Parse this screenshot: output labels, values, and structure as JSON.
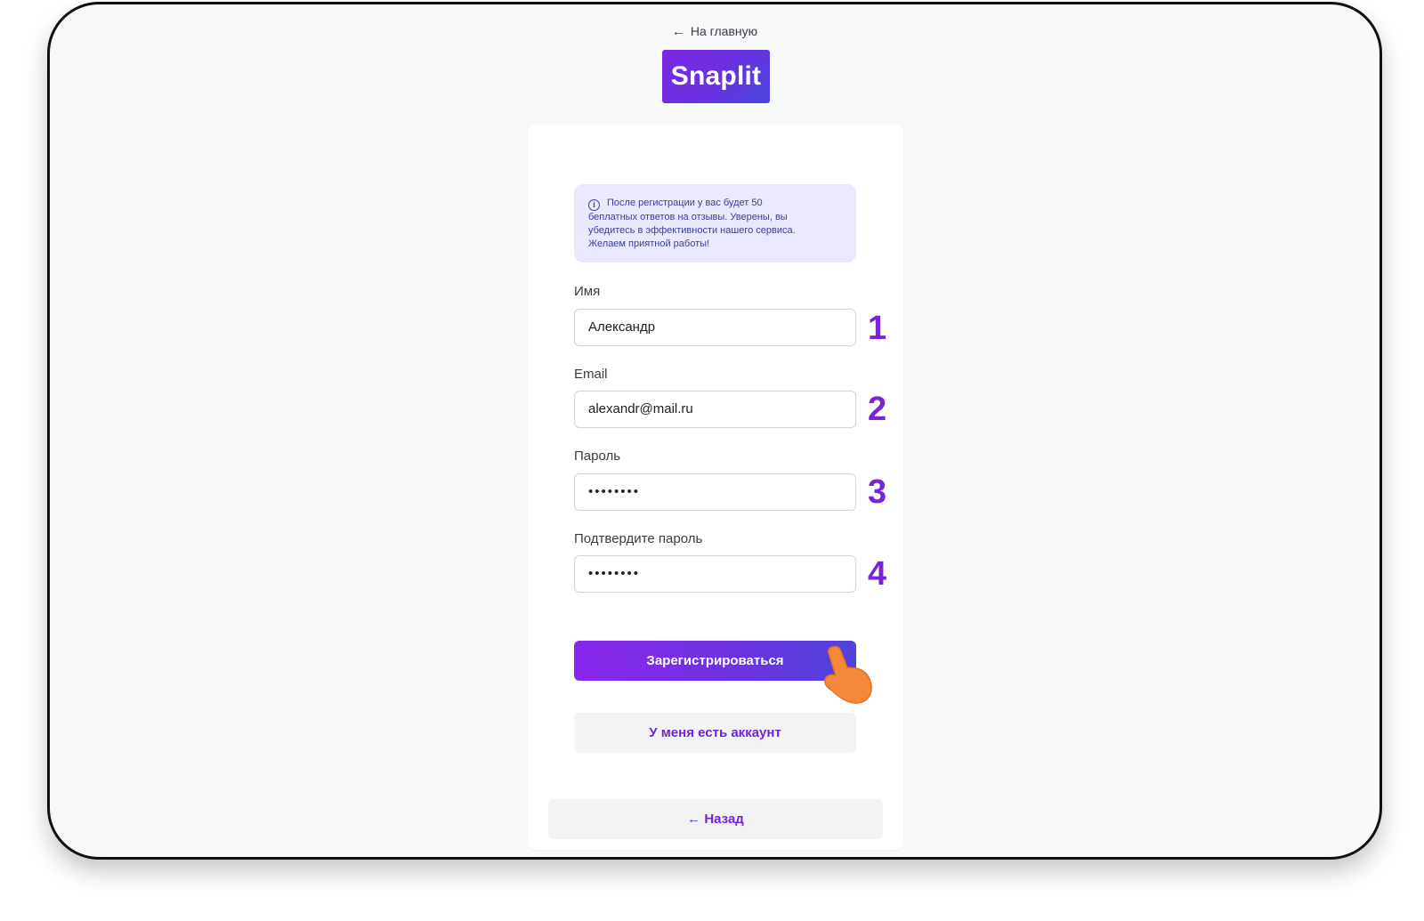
{
  "nav": {
    "back_home_label": "На главную"
  },
  "logo": {
    "text": "Snaplit"
  },
  "info_banner": {
    "lines": [
      "После регистрации у вас будет 50",
      "беплатных ответов на отзывы. Уверены, вы",
      "убедитесь в эффективности нашего сервиса.",
      "Желаем приятной работы!"
    ]
  },
  "form": {
    "name": {
      "label": "Имя",
      "value": "Александр",
      "step": "1"
    },
    "email": {
      "label": "Email",
      "value": "alexandr@mail.ru",
      "step": "2"
    },
    "password": {
      "label": "Пароль",
      "value": "••••••••",
      "step": "3"
    },
    "confirm_password": {
      "label": "Подтвердите пароль",
      "value": "••••••••",
      "step": "4"
    },
    "submit_label": "Зарегистрироваться",
    "have_account_label": "У меня есть аккаунт",
    "back_label": "← Назад"
  },
  "colors": {
    "accent": "#7a24d8",
    "info_bg": "#eae8fc",
    "cursor_hand": "#f5893a"
  }
}
